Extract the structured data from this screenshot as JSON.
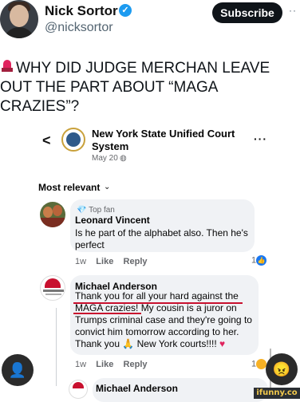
{
  "tweet": {
    "author_name": "Nick Sortor",
    "author_handle": "@nicksortor",
    "subscribe_label": "Subscribe",
    "more_icon": "more-dots-icon",
    "headline": "WHY DID JUDGE MERCHAN LEAVE OUT THE PART ABOUT “MAGA CRAZIES”?"
  },
  "fb_post": {
    "page_name": "New York State Unified Court System",
    "date": "May 20 ·",
    "sort_label": "Most relevant"
  },
  "comments": [
    {
      "badge": "Top fan",
      "author": "Leonard Vincent",
      "text": "Is he part of the alphabet also. Then he's perfect",
      "time": "1w",
      "like_label": "Like",
      "reply_label": "Reply",
      "reaction_count": "1"
    },
    {
      "author": "Michael Anderson",
      "text_line1": "Thank you for all your hard against the",
      "text_line2": "MAGA crazies! My cousin is a juror on",
      "text_line3": "Trumps criminal case and they're going to",
      "text_line4": "convict him tomorrow according to her.",
      "text_line5": "Thank you 🙏 New York courts!!!! ",
      "time": "1w",
      "like_label": "Like",
      "reply_label": "Reply",
      "reaction_count": "1"
    },
    {
      "author": "Michael Anderson"
    }
  ],
  "watermark": "ifunny.co",
  "colors": {
    "accent_red": "#c8102e",
    "fb_blue": "#1877f2",
    "x_blue": "#1d9bf0"
  }
}
